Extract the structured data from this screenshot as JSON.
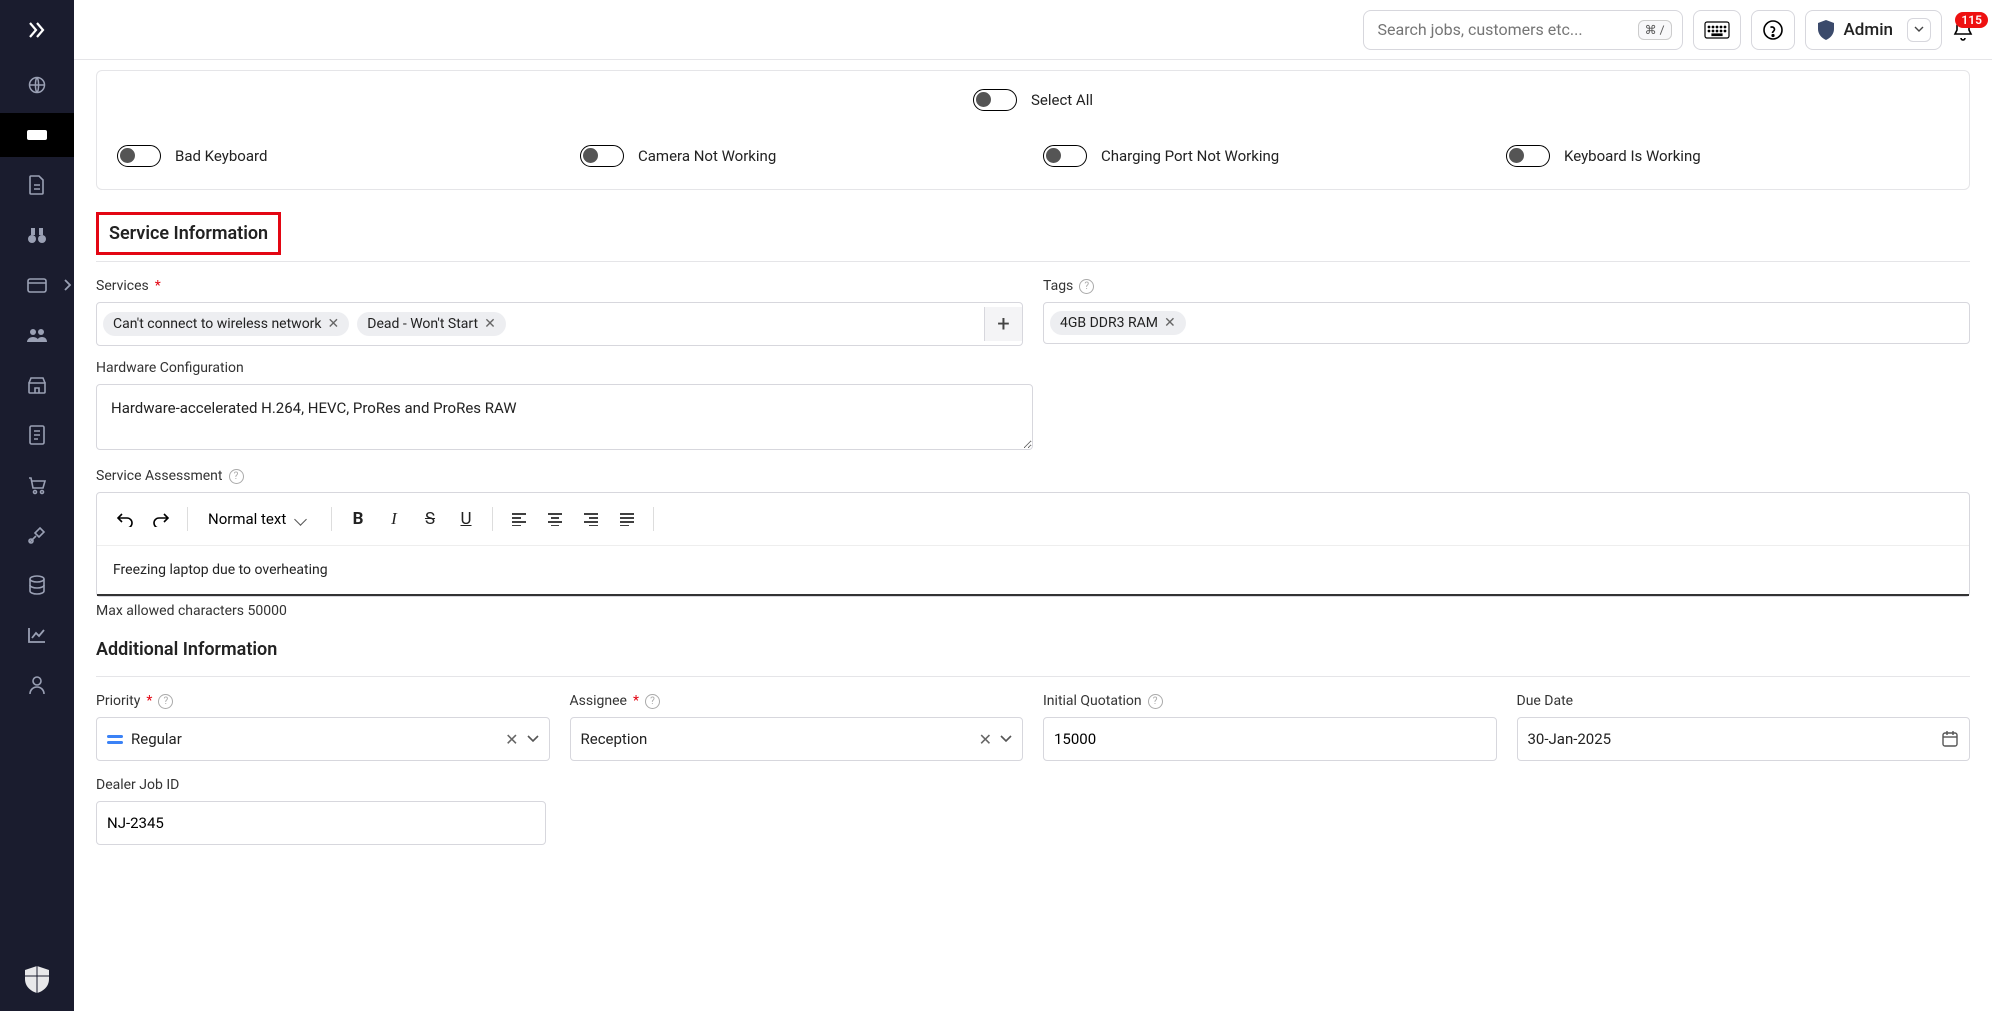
{
  "topbar": {
    "search_placeholder": "Search jobs, customers etc...",
    "search_shortcut": "⌘ /",
    "admin_label": "Admin",
    "notification_count": "115"
  },
  "sidebar_items": [
    {
      "name": "globe-icon"
    },
    {
      "name": "ticket-icon",
      "active": true
    },
    {
      "name": "file-icon"
    },
    {
      "name": "binoculars-icon"
    },
    {
      "name": "wallet-icon",
      "flyout": true
    },
    {
      "name": "users-icon"
    },
    {
      "name": "store-icon"
    },
    {
      "name": "document-icon"
    },
    {
      "name": "cart-icon"
    },
    {
      "name": "tools-icon"
    },
    {
      "name": "database-icon"
    },
    {
      "name": "chart-icon"
    },
    {
      "name": "person-icon"
    }
  ],
  "checklist": {
    "select_all_label": "Select All",
    "items": [
      {
        "label": "Bad Keyboard"
      },
      {
        "label": "Camera Not Working"
      },
      {
        "label": "Charging Port Not Working"
      },
      {
        "label": "Keyboard Is Working"
      }
    ]
  },
  "service_info": {
    "section_title": "Service Information",
    "services_label": "Services",
    "services_tags": [
      "Can't connect to wireless network",
      "Dead - Won't Start"
    ],
    "tags_label": "Tags",
    "tags": [
      "4GB DDR3 RAM"
    ],
    "hardware_label": "Hardware Configuration",
    "hardware_value": "Hardware-accelerated H.264, HEVC, ProRes and ProRes RAW",
    "assessment_label": "Service Assessment",
    "editor": {
      "text_style": "Normal text",
      "body": "Freezing laptop due to overheating",
      "max_chars_label": "Max allowed characters 50000"
    }
  },
  "additional": {
    "section_title": "Additional Information",
    "priority_label": "Priority",
    "priority_value": "Regular",
    "assignee_label": "Assignee",
    "assignee_value": "Reception",
    "quotation_label": "Initial Quotation",
    "quotation_value": "15000",
    "due_date_label": "Due Date",
    "due_date_value": "30-Jan-2025",
    "dealer_job_label": "Dealer Job ID",
    "dealer_job_value": "NJ-2345"
  }
}
